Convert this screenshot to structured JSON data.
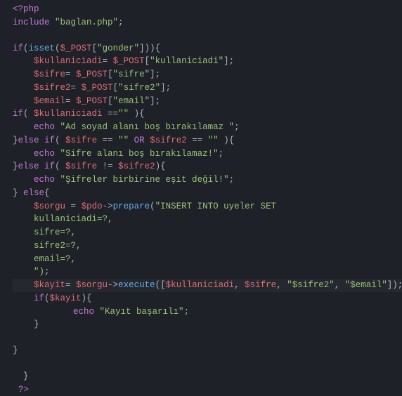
{
  "open_tag": "<?php",
  "include_kw": "include",
  "include_file": "\"baglan.php\"",
  "semi": ";",
  "if_kw": "if",
  "isset_fn": "isset",
  "post_global": "$_POST",
  "gonder_key": "\"gonder\"",
  "kullaniciadi_key": "\"kullaniciadi\"",
  "sifre_key": "\"sifre\"",
  "sifre2_key": "\"sifre2\"",
  "email_key": "\"email\"",
  "kullaniciadi_var": "$kullaniciadi",
  "sifre_var": "$sifre",
  "sifre2_var": "$sifre2",
  "email_var": "$email",
  "empty_str": "\"\"",
  "eq_op": "==",
  "neq_op": "!=",
  "or_kw": "OR",
  "echo_kw": "echo",
  "msg_adsoyad": "\"Ad soyad alanı boş bırakılamaz \"",
  "msg_sifre_bos": "\"Sifre alanı boş bırakılamaz!\"",
  "msg_sifre_esit": "\"Şifreler birbirine eşit değil!\"",
  "else_kw": "else",
  "sorgu_var": "$sorgu",
  "pdo_var": "$pdo",
  "prepare_fn": "prepare",
  "sql_insert": "\"INSERT INTO uyeler SET",
  "sql_kul": "kullaniciadi=?,",
  "sql_sifre": "sifre=?,",
  "sql_sifre2": "sifre2=?,",
  "sql_email": "email=?,",
  "sql_close": "\")",
  "kayit_var": "$kayit",
  "execute_fn": "execute",
  "str_sifre2": "\"$sifre2\"",
  "str_email": "\"$email\"",
  "msg_kayit": "\"Kayıt başarılı\"",
  "close_tag": "?>",
  "arrow": "->",
  "assign": "=",
  "comma": ", "
}
